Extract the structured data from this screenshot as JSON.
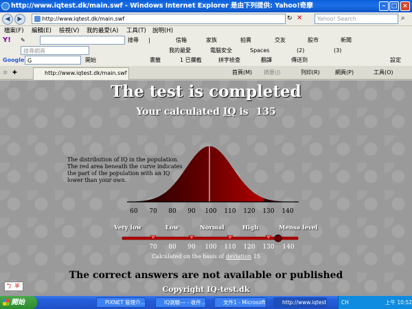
{
  "window": {
    "title": "http://www.iqtest.dk/main.swf - Windows Internet Explorer 是由下列提供: Yahoo!奇摩"
  },
  "address_bar": {
    "url": "http://www.iqtest.dk/main.swf",
    "search_placeholder": "Yahoo! Search"
  },
  "menu": [
    "檔案(F)",
    "編輯(E)",
    "檢視(V)",
    "我的最愛(A)",
    "工具(T)",
    "說明(H)"
  ],
  "yahoo_toolbar": {
    "logo": "Y!",
    "search_button": "搜尋",
    "items": [
      "信箱",
      "家族",
      "拍賣",
      "交友",
      "股市",
      "新聞"
    ]
  },
  "toolbar2": {
    "search_placeholder": "搜尋網頁",
    "items": [
      "我的最愛",
      "電腦安全",
      "Spaces",
      "(2)",
      "(3)"
    ]
  },
  "google_toolbar": {
    "logo": "Google",
    "field": "G",
    "items": [
      "開始",
      "書籤",
      "1 已攔截",
      "拼字檢查",
      "翻譯",
      "傳送到",
      "設定"
    ]
  },
  "tabs": {
    "active_url": "http://www.iqtest.dk/main.swf",
    "command_bar": [
      "首頁(M)",
      "摘要(J)",
      "列印(R)",
      "網頁(P)",
      "工具(O)"
    ]
  },
  "page": {
    "title": "The test is completed",
    "result_prefix": "Your calculated",
    "result_abbr": "IQ",
    "result_is": "is",
    "iq_value": "135",
    "note": "The distribution of IQ in the population. The red area beneath the curve indicates the part of the population with an IQ lower than your own.",
    "scale_ticks": [
      "60",
      "70",
      "80",
      "90",
      "100",
      "110",
      "120",
      "130",
      "140"
    ],
    "category_labels": [
      "Very low",
      "Low",
      "Normal",
      "High",
      "Mensa level"
    ],
    "slider_ticks": [
      "70",
      "80",
      "90",
      "100",
      "110",
      "120",
      "130",
      "140"
    ],
    "basis_prefix": "Calculated on the basis of",
    "basis_link": "deviation",
    "basis_value": "15",
    "answers_note": "The correct answers are not available or published",
    "copyright": "Copyright IQ-test.dk",
    "ime": [
      "ㄅ",
      "半"
    ]
  },
  "colors": {
    "page_bg": "#9a9a9a",
    "curve_red": "#c00000",
    "track_red": "#b00000"
  },
  "taskbar": {
    "start": "開始",
    "tasks": [
      "PIXNET 管理介...",
      "IQ測驗--- - 收件...",
      "文件1 - Microsoft...",
      "http://www.iqtest.d..."
    ],
    "tray_lang": "CH",
    "clock": "上午 10:52"
  }
}
